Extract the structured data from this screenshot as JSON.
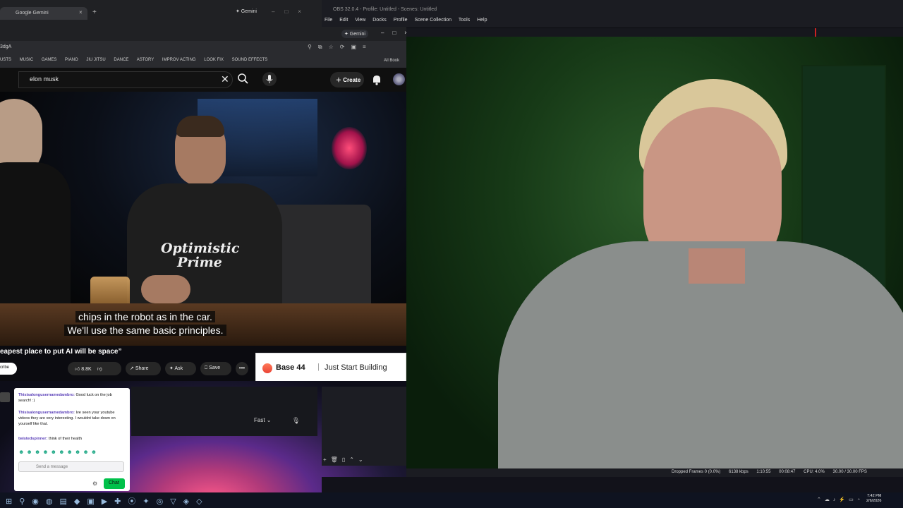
{
  "browser": {
    "tab_title": "Google Gemini",
    "tab_close": "×",
    "new_tab": "+",
    "gemini_badge": "✦ Gemini",
    "gemini_badge_2": "✦ Gemini",
    "address_fragment": "3dgA",
    "bookmarks": [
      "USTS",
      "MUSIC",
      "GAMES",
      "PIANO",
      "JIU JITSU",
      "DANCE",
      "ASTORY",
      "IMPROV ACTING",
      "LOOK FIX",
      "SOUND EFFECTS"
    ],
    "all_bookmarks": "All Book"
  },
  "obs": {
    "title": "OBS 32.0.4 - Profile: Untitled - Scenes: Untitled",
    "menu": [
      "File",
      "Edit",
      "View",
      "Docks",
      "Profile",
      "Scene Collection",
      "Tools",
      "Help"
    ]
  },
  "youtube": {
    "search_value": "elon musk",
    "create_label": "Create",
    "subtitle_line1": "chips in the robot as in the car.",
    "subtitle_line2": "We'll use the same basic principles.",
    "shirt_line1": "Optimistic",
    "shirt_line2": "Prime",
    "video_title": "eapest place to put AI will be space”",
    "subscribe_label": "cribe",
    "like_count": "8.8K",
    "share_label": "Share",
    "ask_label": "Ask",
    "save_label": "Save",
    "more_label": "•••"
  },
  "ad": {
    "brand": "Base 44",
    "separator": "|",
    "tagline": "Just Start Building"
  },
  "gemini_panel": {
    "mode": "Fast",
    "mode_chevron": "⌄"
  },
  "chat": {
    "messages": [
      {
        "user": "Thisisalongusernamedambro:",
        "text": " Good luck on the job search! :)"
      },
      {
        "user": "Thisisalongusernamedambro:",
        "text": " Ive seen your youtube videos they are very interesting. I wouldnt take down on yourself like that."
      },
      {
        "user": "twistedspinner:",
        "text": " think of their health"
      }
    ],
    "input_placeholder": "Send a message",
    "chat_button": "Chat"
  },
  "status_bar": {
    "dropped_frames": "Dropped Frames 0 (0.0%)",
    "bitrate": "6138 kbps",
    "stream_time": "1:10:55",
    "rec_time": "00:08:47",
    "cpu": "CPU: 4.0%",
    "fps": "30.00 / 30.00 FPS"
  },
  "clock": {
    "time": "7:42 PM",
    "date": "2/6/2026"
  },
  "colors": {
    "youtube_bg": "#0f0f0f",
    "chat_button": "#00c14a",
    "webcam_bg": "#0d2210",
    "ad_logo": "#ff7a59"
  }
}
